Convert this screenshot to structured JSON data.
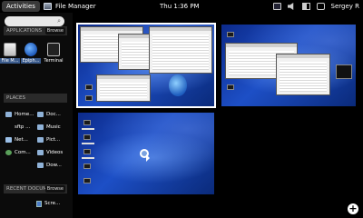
{
  "panel": {
    "activities": "Activities",
    "app_name": "File Manager",
    "clock": "Thu  1:36 PM",
    "user": "Sergey R"
  },
  "sidebar": {
    "search_placeholder": "",
    "applications_header": "APPLICATIONS",
    "browse_label": "Browse",
    "apps": [
      {
        "label": "File M..."
      },
      {
        "label": "Epiph..."
      },
      {
        "label": "Terminal"
      }
    ],
    "places_header": "PLACES",
    "places_left": [
      "Home...",
      "sftp ...",
      "Net...",
      "Com..."
    ],
    "places_right": [
      "Doc...",
      "Music",
      "Pict...",
      "Videos",
      "Dow..."
    ],
    "recent_header": "RECENT DOCUMENTS",
    "recent_browse": "Browse",
    "recent_items": [
      "Scre..."
    ]
  },
  "workspaces": {
    "add_label": "+"
  },
  "icons": {
    "search": "search-icon",
    "display": "display-icon",
    "volume": "volume-icon",
    "battery": "battery-icon",
    "chat": "chat-icon",
    "add": "add-workspace-icon"
  },
  "colors": {
    "panel_bg": "#000000",
    "selection": "#3b5b8c",
    "desktop_blue": "#1d4fc6"
  }
}
